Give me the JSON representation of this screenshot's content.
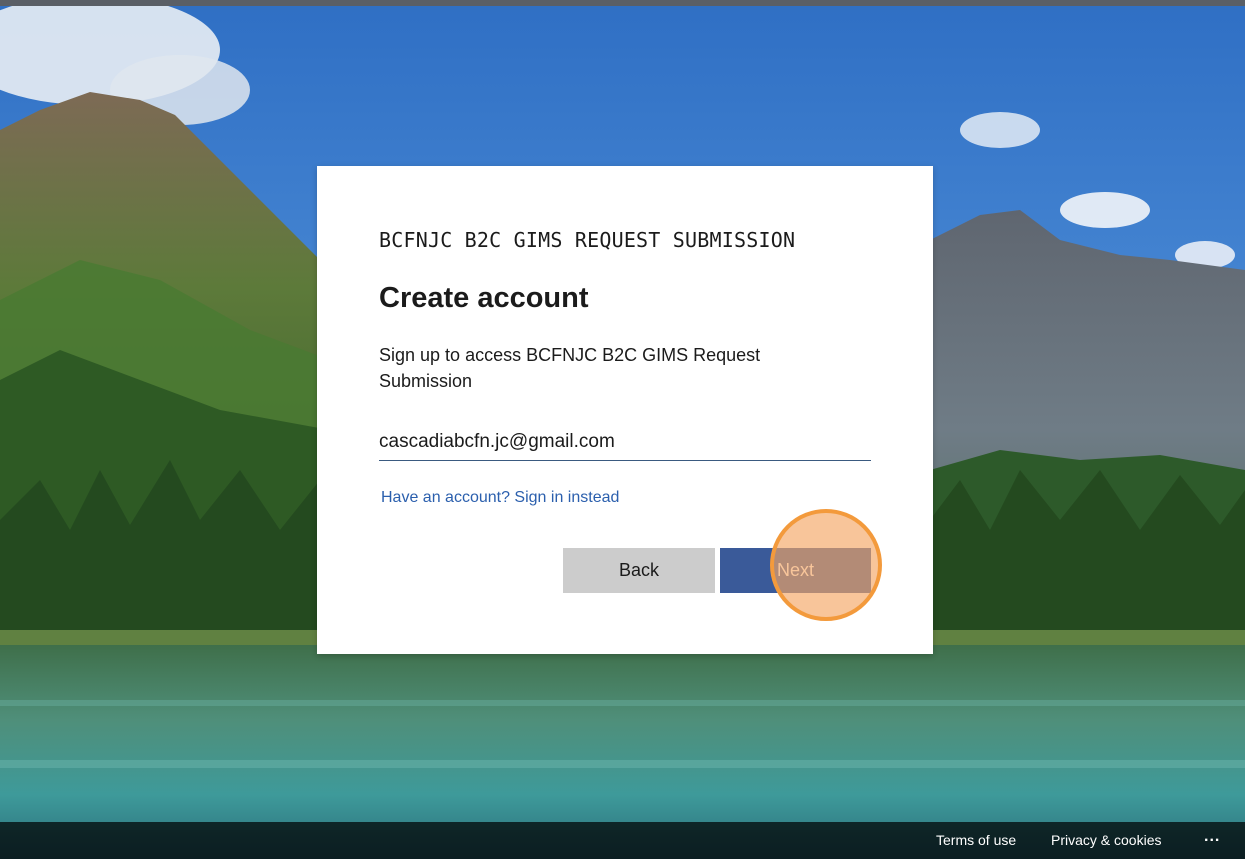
{
  "card": {
    "app_title": "BCFNJC B2C GIMS REQUEST SUBMISSION",
    "heading": "Create account",
    "description": "Sign up to access BCFNJC B2C GIMS Request Submission",
    "email_value": "cascadiabcfn.jc@gmail.com",
    "signin_link": "Have an account? Sign in instead",
    "back_label": "Back",
    "next_label": "Next"
  },
  "footer": {
    "terms_label": "Terms of use",
    "privacy_label": "Privacy & cookies",
    "more_label": "..."
  },
  "colors": {
    "primary_button": "#3a5a99",
    "secondary_button": "#cccccc",
    "link": "#2b5fad",
    "highlight_ring": "#f39a3c"
  },
  "background": {
    "icon": "mountain-lake-landscape"
  }
}
